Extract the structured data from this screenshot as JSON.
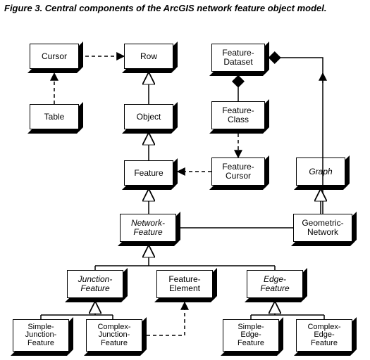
{
  "title": "Figure 3. Central components of the ArcGIS network feature object model.",
  "boxes": {
    "cursor": "Cursor",
    "row": "Row",
    "table": "Table",
    "object": "Object",
    "feature": "Feature",
    "featureDataset": "Feature-\nDataset",
    "featureClass": "Feature-\nClass",
    "featureCursor": "Feature-\nCursor",
    "graph": "Graph",
    "networkFeature": "Network-\nFeature",
    "geometricNetwork": "Geometric-\nNetwork",
    "junctionFeature": "Junction-\nFeature",
    "featureElement": "Feature-\nElement",
    "edgeFeature": "Edge-\nFeature",
    "simpleJunctionFeature": "Simple-\nJunction-\nFeature",
    "complexJunctionFeature": "Complex-\nJunction-\nFeature",
    "simpleEdgeFeature": "Simple-\nEdge-\nFeature",
    "complexEdgeFeature": "Complex-\nEdge-\nFeature"
  },
  "relations": [
    {
      "from": "Cursor",
      "to": "Row",
      "type": "dashed-arrow"
    },
    {
      "from": "Table",
      "to": "Cursor",
      "type": "dashed-arrow"
    },
    {
      "from": "Object",
      "to": "Row",
      "type": "generalization"
    },
    {
      "from": "Feature",
      "to": "Object",
      "type": "generalization"
    },
    {
      "from": "NetworkFeature",
      "to": "Feature",
      "type": "generalization"
    },
    {
      "from": "FeatureCursor",
      "to": "Feature",
      "type": "dashed-arrow"
    },
    {
      "from": "FeatureClass",
      "to": "FeatureCursor",
      "type": "dashed-arrow"
    },
    {
      "from": "FeatureClass",
      "to": "FeatureDataset",
      "type": "composition"
    },
    {
      "from": "GeometricNetwork",
      "to": "FeatureDataset",
      "type": "composition-up-arrow"
    },
    {
      "from": "GeometricNetwork",
      "to": "Graph",
      "type": "generalization"
    },
    {
      "from": "NetworkFeature",
      "to": "GeometricNetwork",
      "type": "association"
    },
    {
      "from": "JunctionFeature",
      "to": "NetworkFeature",
      "type": "generalization"
    },
    {
      "from": "EdgeFeature",
      "to": "NetworkFeature",
      "type": "generalization"
    },
    {
      "from": "SimpleJunctionFeature",
      "to": "JunctionFeature",
      "type": "generalization"
    },
    {
      "from": "ComplexJunctionFeature",
      "to": "JunctionFeature",
      "type": "generalization"
    },
    {
      "from": "SimpleEdgeFeature",
      "to": "EdgeFeature",
      "type": "generalization"
    },
    {
      "from": "ComplexEdgeFeature",
      "to": "EdgeFeature",
      "type": "generalization"
    },
    {
      "from": "ComplexJunctionFeature",
      "to": "FeatureElement",
      "type": "dashed-arrow"
    }
  ]
}
